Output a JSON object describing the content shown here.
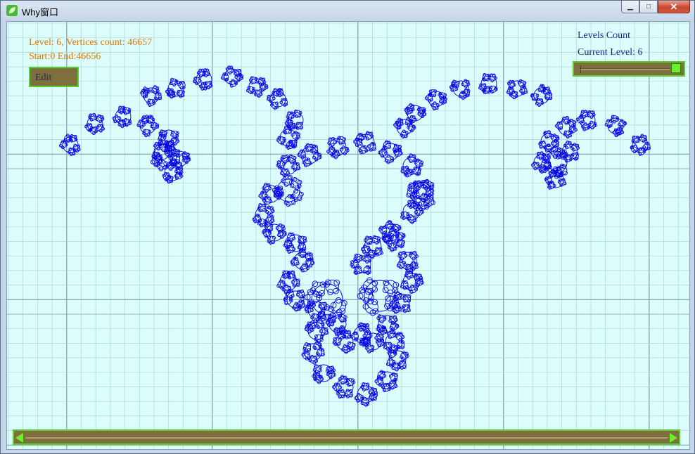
{
  "window": {
    "title": "Why窗口",
    "controls": {
      "minimize": "▁",
      "maximize": "□",
      "close": "✕"
    }
  },
  "info": {
    "levels_line": "Level: 6, Vertices count: 46657",
    "range_line": "Start:0 End:46656",
    "color": "#e07800"
  },
  "edit_button": {
    "label": "Edit"
  },
  "level_panel": {
    "levels_count_label": "Levels Count",
    "current_level_label": "Current Level: 6",
    "text_color": "#1a2a8a"
  },
  "level_slider": {
    "value_fraction": 1.0
  },
  "horizontal_scrollbar": {
    "value_fraction": 0.0
  },
  "fractal": {
    "color": "#0000e6",
    "level": 6,
    "vertices": 46657
  },
  "colors": {
    "canvas_bg": "#ddfdfd",
    "grid_minor": "#a7d6d4",
    "grid_major": "#7e9fa6",
    "control_bg": "#7f6f3f",
    "control_border": "#56d12a",
    "thumb": "#6cf02c"
  },
  "icons": {
    "app": "leaf-app-icon",
    "scroll_left": "triangle-left-icon",
    "scroll_right": "triangle-right-icon"
  }
}
